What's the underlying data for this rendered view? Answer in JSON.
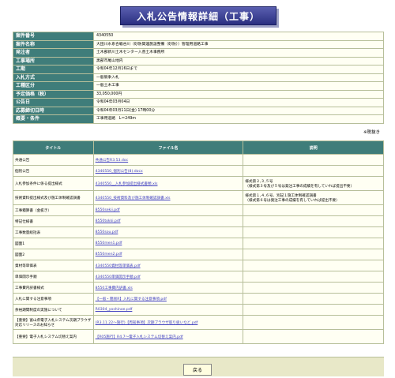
{
  "title": "入札公告情報詳細（工事）",
  "info_rows": [
    {
      "key": "案件番号",
      "value": "4340550"
    },
    {
      "key": "案件名称",
      "value": "大田川水系合戦谷川（砂防関連施設整備（砂防））管理用道路工事"
    },
    {
      "key": "発注者",
      "value": "土木部新川土木センター入善土木事務所"
    },
    {
      "key": "工事場所",
      "value": "黒部市尾山地内"
    },
    {
      "key": "工期",
      "value": "令和04年12月16日まで"
    },
    {
      "key": "入札方式",
      "value": "一般競争入札"
    },
    {
      "key": "工種区分",
      "value": "一般土木工事"
    },
    {
      "key": "予定価格（税）",
      "value": "33,050,000円"
    },
    {
      "key": "公告日",
      "value": "令和04年03月04日"
    },
    {
      "key": "応募締切日時",
      "value": "令和04年03月11日(金) 17時00分"
    },
    {
      "key": "概要・条件",
      "value": "工事用道路　L＝249m"
    }
  ],
  "note": "※税抜き",
  "docs_header": {
    "title": "タイトル",
    "file": "ファイル名",
    "remarks": "説明"
  },
  "docs": [
    {
      "title": "共通公告",
      "file": "共通公告R3.53.doc",
      "remarks": ""
    },
    {
      "title": "個別公告",
      "file": "4340550_個別公告(8).docx",
      "remarks": ""
    },
    {
      "title": "入札参加条件に係る提出様式",
      "file": "4340550__入札参加提出様式書類.xls",
      "remarks": "様式第２,３,５号\n（様式第３号及び５号は発注工事の成績を有していれば提出不要）"
    },
    {
      "title": "技術資料提出様式及び施工体制確認調書",
      "file": "4340550_技術資料及び施工体制確認調書.xls",
      "remarks": "様式第１,４,６号、別記１施工体制確認調書\n（様式第６号は発注工事の成績を有していれば提出不要）"
    },
    {
      "title": "工事積算書（金抜き）",
      "file": "8550sekii.pdf",
      "remarks": ""
    },
    {
      "title": "特記仕様書",
      "file": "8550tokki.pdf",
      "remarks": ""
    },
    {
      "title": "工事数量総括表",
      "file": "8550sou.pdf",
      "remarks": ""
    },
    {
      "title": "図面1",
      "file": "8550men1.pdf",
      "remarks": ""
    },
    {
      "title": "図面2",
      "file": "8550men2.pdf",
      "remarks": ""
    },
    {
      "title": "資材等単価表",
      "file": "4340550資材等単価表.pdf",
      "remarks": ""
    },
    {
      "title": "単価開示手順",
      "file": "4340550単価開示手順.pdf",
      "remarks": ""
    },
    {
      "title": "工事費内訳書様式",
      "file": "8550工事費内訳書.xls",
      "remarks": ""
    },
    {
      "title": "入札に関する注意事項",
      "file": "【一般・簡易R】入札に関する注意事項.pdf",
      "remarks": ""
    },
    {
      "title": "余裕期間制度の実施について",
      "file": "R0304_yoshinoe.pdf",
      "remarks": ""
    },
    {
      "title": "【重要】富山県電子入札システム次期ブラウザ対応リリースのお知らせ",
      "file": "(R3.11.22〜施行)【周知事項】次期ブラウザ取り扱いなど.pdf",
      "remarks": ""
    },
    {
      "title": "【重要】電子入札システム切替え案内",
      "file": "【R05施行】R4.7〜電子入札システム切替え案内.pdf",
      "remarks": ""
    }
  ],
  "back_label": "戻る"
}
